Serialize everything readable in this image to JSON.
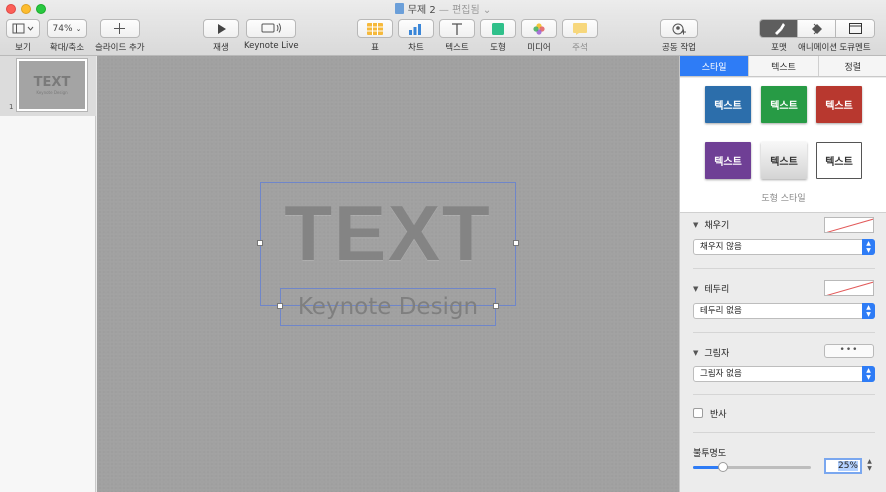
{
  "window": {
    "title": "무제 2",
    "title_sep": " — ",
    "subtitle": "편집됨"
  },
  "toolbar": {
    "view_label": "보기",
    "zoom_value": "74%",
    "zoom_label": "확대/축소",
    "add_slide_label": "슬라이드 추가",
    "play_label": "재생",
    "keynote_live_label": "Keynote Live",
    "table_label": "표",
    "chart_label": "차트",
    "text_label": "텍스트",
    "shape_label": "도형",
    "media_label": "미디어",
    "comment_label": "주석",
    "collaborate_label": "공동 작업",
    "format_label": "포맷",
    "animate_label": "애니메이션",
    "document_label": "도큐멘트"
  },
  "navigator": {
    "slide_number": "1",
    "thumb_title": "TEXT",
    "thumb_subtitle": "Keynote Design"
  },
  "slide": {
    "title": "TEXT",
    "subtitle": "Keynote Design"
  },
  "inspector": {
    "tabs": [
      "스타일",
      "텍스트",
      "정렬"
    ],
    "active_tab": 0,
    "style_swatches": [
      {
        "label": "텍스트",
        "color": "#2c6eab"
      },
      {
        "label": "텍스트",
        "color": "#279b45"
      },
      {
        "label": "텍스트",
        "color": "#b8382f"
      },
      {
        "label": "텍스트",
        "color": "#6f3f95"
      },
      {
        "label": "텍스트",
        "color": "#e7e7e7"
      },
      {
        "label": "텍스트",
        "color": "#ffffff"
      }
    ],
    "shape_style_label": "도형 스타일",
    "fill": {
      "title": "채우기",
      "value": "채우지 않음"
    },
    "border": {
      "title": "테두리",
      "value": "테두리 없음"
    },
    "shadow": {
      "title": "그림자",
      "value": "그림자 없음"
    },
    "reflection": {
      "label": "반사",
      "checked": false
    },
    "opacity": {
      "label": "불투명도",
      "value": "25%",
      "fraction": 0.25
    }
  },
  "colors": {
    "accent": "#2e7cf6",
    "canvas": "#a1a1a1",
    "title_text": "#848484"
  }
}
